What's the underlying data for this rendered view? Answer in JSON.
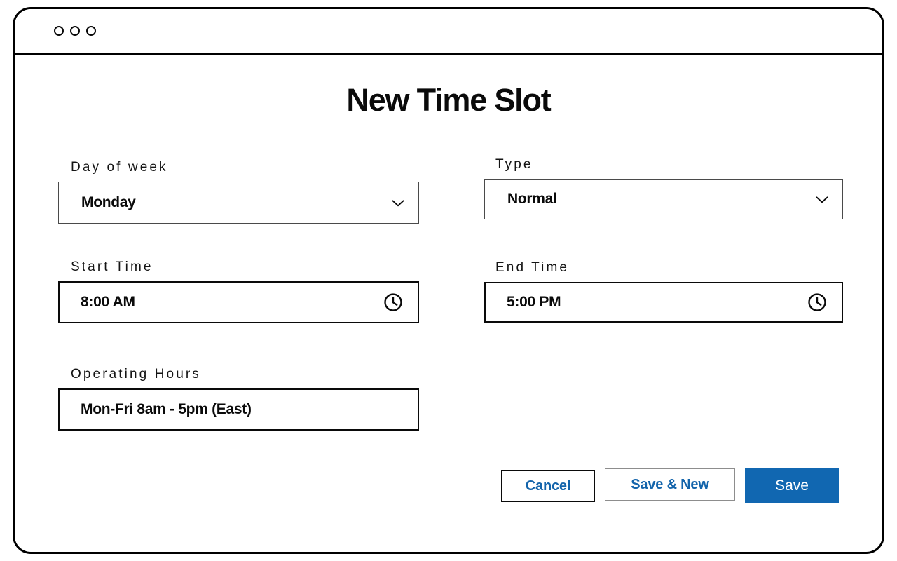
{
  "window": {
    "controls": [
      {
        "name": "close",
        "shape": "circle-outline"
      },
      {
        "name": "minimize",
        "shape": "circle-outline"
      },
      {
        "name": "maximize",
        "shape": "circle-outline"
      }
    ]
  },
  "header": {
    "title": "New Time Slot"
  },
  "form": {
    "fields": {
      "day_of_week": {
        "label": "Day of week",
        "value": "Monday",
        "icon": "chevron-down-icon",
        "control": "select"
      },
      "type": {
        "label": "Type",
        "value": "Normal",
        "icon": "chevron-down-icon",
        "control": "select"
      },
      "start_time": {
        "label": "Start Time",
        "value": "8:00 AM",
        "icon": "clock-icon",
        "control": "time"
      },
      "end_time": {
        "label": "End Time",
        "value": "5:00 PM",
        "icon": "clock-icon",
        "control": "time"
      },
      "operating_hours": {
        "label": "Operating Hours",
        "value": "Mon-Fri 8am - 5pm (East)",
        "control": "text"
      }
    }
  },
  "actions": {
    "cancel_label": "Cancel",
    "save_new_label": "Save & New",
    "save_label": "Save"
  },
  "colors": {
    "accent_blue": "#1167b1",
    "link_blue": "#1364ab",
    "border_black": "#0a0a0a",
    "border_gray": "#8d8d8d",
    "page_background": "#ffffff"
  }
}
